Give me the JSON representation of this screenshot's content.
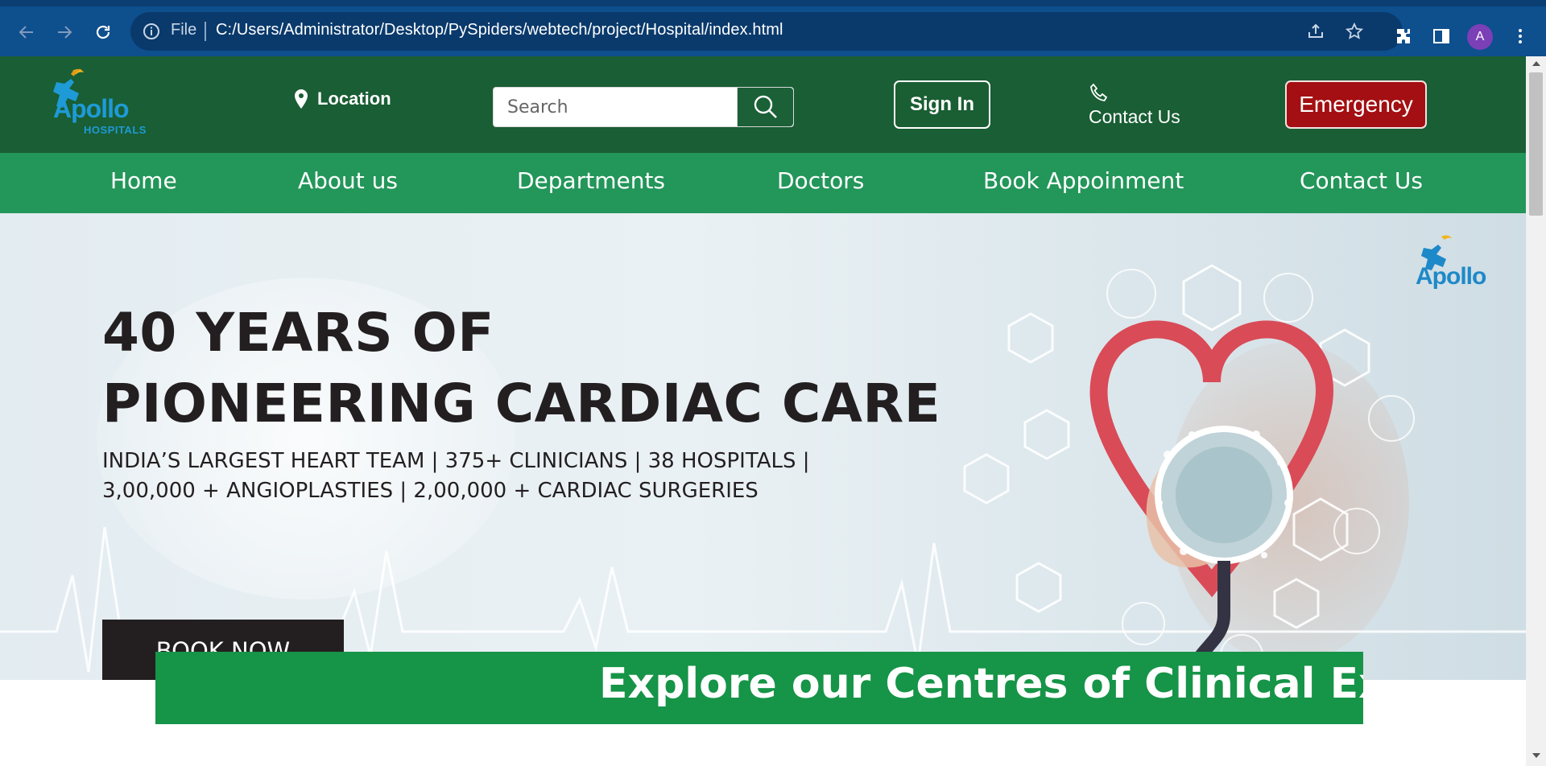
{
  "browser": {
    "omnibox_scheme": "File",
    "url": "C:/Users/Administrator/Desktop/PySpiders/webtech/project/Hospital/index.html",
    "profile_initial": "A",
    "colors": {
      "frame": "#0e4f8e",
      "omnibox": "#0a3a6c"
    }
  },
  "header": {
    "logo_text": "Apollo",
    "logo_sub": "HOSPITALS",
    "location_label": "Location",
    "search_placeholder": "Search",
    "signin_label": "Sign In",
    "contact_label": "Contact Us",
    "emergency_label": "Emergency",
    "colors": {
      "band": "#195e34",
      "emergency": "#a30f12"
    }
  },
  "nav": {
    "items": [
      {
        "label": "Home"
      },
      {
        "label": "About us"
      },
      {
        "label": "Departments"
      },
      {
        "label": "Doctors"
      },
      {
        "label": "Book Appoinment"
      },
      {
        "label": "Contact Us"
      }
    ],
    "color": "#23965a"
  },
  "hero": {
    "title_line1": "40 YEARS OF",
    "title_line2": "PIONEERING CARDIAC CARE",
    "subtitle_line1": "INDIA’S LARGEST HEART TEAM | 375+ CLINICIANS | 38 HOSPITALS |",
    "subtitle_line2": "3,00,000 + ANGIOPLASTIES | 2,00,000 + CARDIAC SURGERIES",
    "cta_label": "BOOK NOW",
    "brand_logo_text": "Apollo"
  },
  "banner": {
    "text": "Explore our Centres of Clinical Excellence",
    "color": "#169447"
  }
}
